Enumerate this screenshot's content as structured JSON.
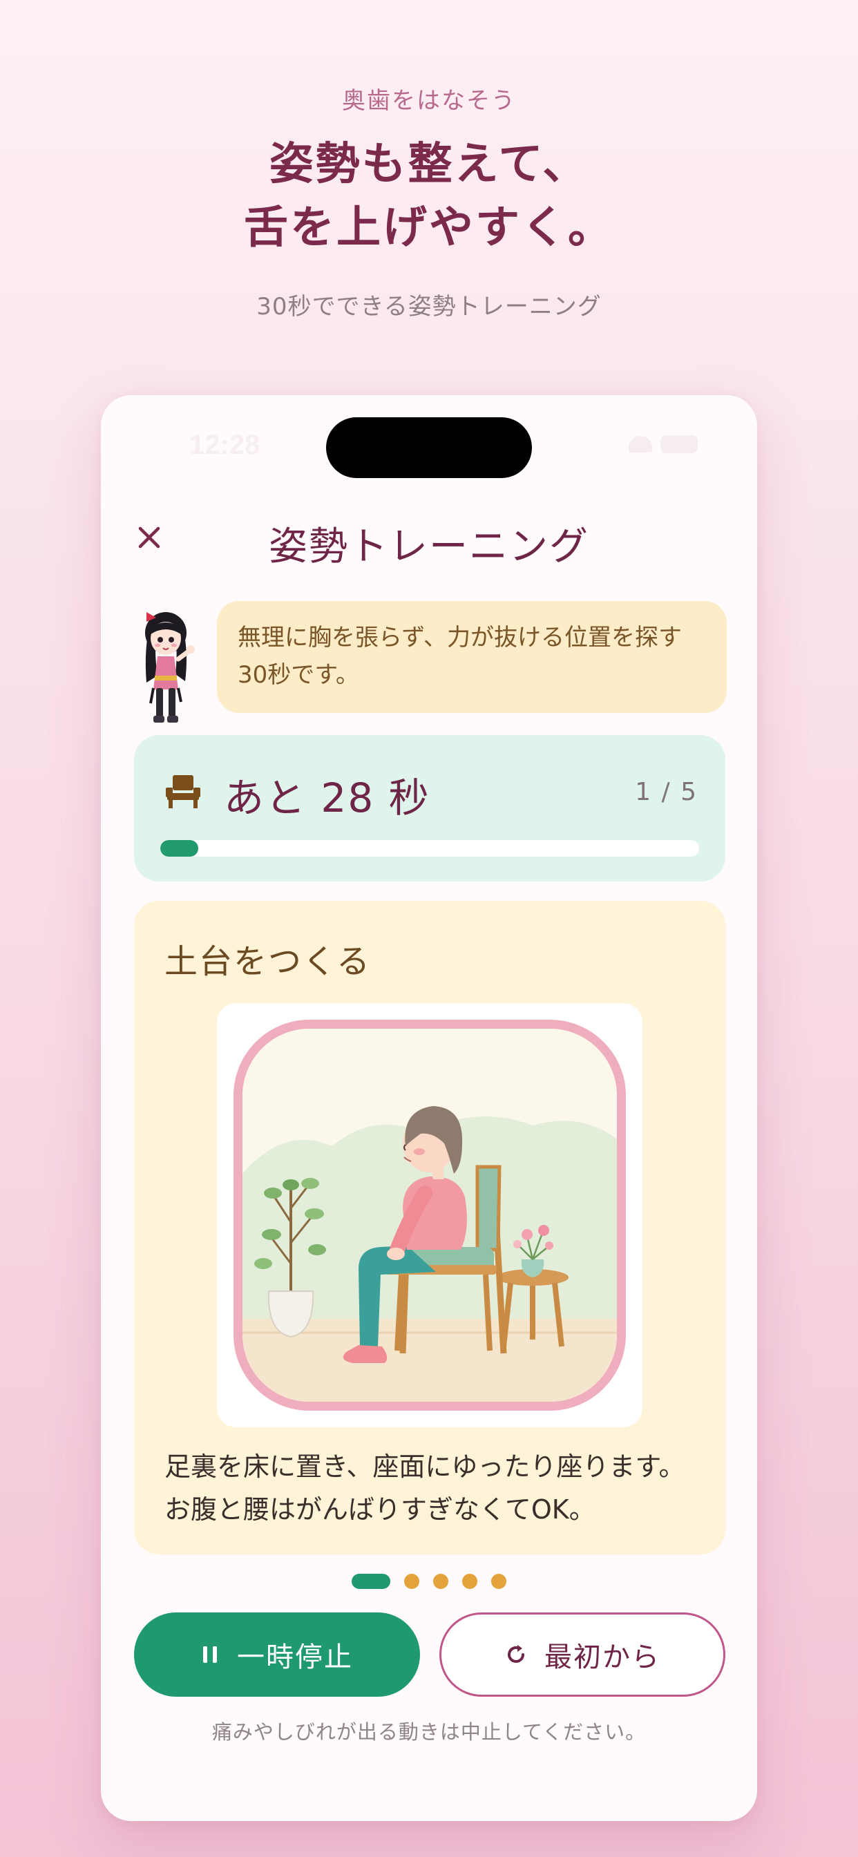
{
  "hero": {
    "eyebrow": "奥歯をはなそう",
    "title_line1": "姿勢も整えて、",
    "title_line2": "舌を上げやすく。",
    "subtitle": "30秒でできる姿勢トレーニング"
  },
  "status_bar": {
    "time": "12:28"
  },
  "screen": {
    "title": "姿勢トレーニング",
    "close_icon": "close-icon"
  },
  "mascot": {
    "message": "無理に胸を張らず、力が抜ける位置を探す30秒です。"
  },
  "timer": {
    "icon": "chair-icon",
    "remaining_text": "あと 28 秒",
    "step_indicator": "1 / 5",
    "progress": 0.07
  },
  "step": {
    "title": "土台をつくる",
    "description": "足裏を床に置き、座面にゆったり座ります。お腹と腰はがんばりすぎなくてOK。"
  },
  "pagination": {
    "total": 5,
    "active": 1
  },
  "buttons": {
    "pause_label": "一時停止",
    "restart_label": "最初から"
  },
  "footer": {
    "note": "痛みやしびれが出る動きは中止してください。"
  },
  "colors": {
    "accent_green": "#1f9a70",
    "title_wine": "#7c2a4c",
    "dot_orange": "#e4a33a",
    "frame_pink": "#efaebd"
  }
}
